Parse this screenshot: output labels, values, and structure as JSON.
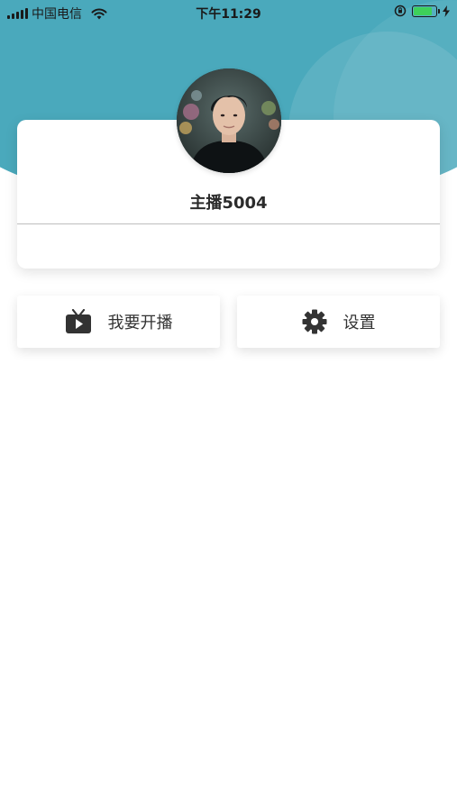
{
  "status_bar": {
    "carrier": "中国电信",
    "time": "下午11:29",
    "battery_level": 0.85
  },
  "profile": {
    "username": "主播5004",
    "avatar_icon": "user-avatar-photo"
  },
  "actions": [
    {
      "label": "我要开播",
      "icon": "tv-play-icon"
    },
    {
      "label": "设置",
      "icon": "gear-icon"
    }
  ],
  "colors": {
    "header": "#4aa9bc",
    "icon": "#333333",
    "battery": "#3ed05a"
  }
}
